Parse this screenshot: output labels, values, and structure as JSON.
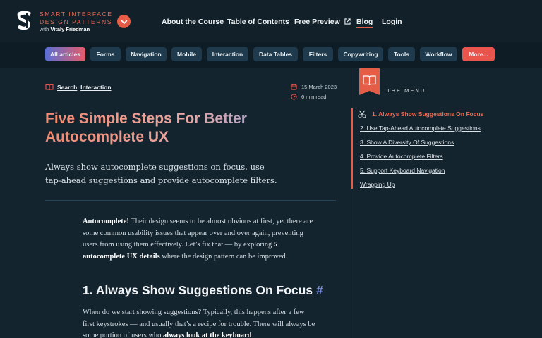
{
  "header": {
    "logo_line1": "SMART INTERFACE",
    "logo_line2": "DESIGN PATTERNS",
    "logo_sub_prefix": "with",
    "logo_sub_name": "Vitaly Friedman",
    "nav": [
      "About the Course",
      "Table of Contents",
      "Free Preview",
      "Blog",
      "Login"
    ],
    "active_nav": "Blog"
  },
  "categories": [
    "All articles",
    "Forms",
    "Navigation",
    "Mobile",
    "Interaction",
    "Data Tables",
    "Filters",
    "Copywriting",
    "Tools",
    "Workflow",
    "More..."
  ],
  "article": {
    "tags": [
      "Search",
      "Interaction"
    ],
    "tag_sep": ",",
    "date": "15 March 2023",
    "read_time": "6 min read",
    "title": "Five Simple Steps For Better Autocomplete UX",
    "subtitle": "Always show autocomplete suggestions on focus, use tap-ahead suggestions and provide autocomplete filters.",
    "intro": {
      "lead_bold": "Autocomplete!",
      "text1": " Their design seems to be almost obvious at first, yet there are some common usability issues that appear over and over again, preventing users from using them effectively. Let’s fix that — by exploring ",
      "bold2": "5 autocomplete UX details",
      "text2": " where the design pattern can be improved."
    },
    "section1_heading": "1. Always Show Suggestions On Focus",
    "section1_anchor": "#",
    "section1_text1": "When do we start showing suggestions? Typically, this happens after a few first keystrokes — and usually that’s a recipe for trouble. There will always be some portion of users who ",
    "section1_bold": "always look at the keyboard"
  },
  "sidebar": {
    "menu_label": "THE MENU",
    "toc": [
      "1. Always Show Suggestions On Focus",
      "2. Use Tap-Ahead Autocomplete Suggestions",
      "3. Show A Diversity Of Suggestions",
      "4. Provide Autocomplete Filters",
      "5. Support Keyboard Navigation",
      "Wrapping Up"
    ]
  },
  "colors": {
    "accent": "#e55c47",
    "background": "#14242f",
    "pill": "#1f3a4d",
    "hash": "#7b8fe6"
  }
}
